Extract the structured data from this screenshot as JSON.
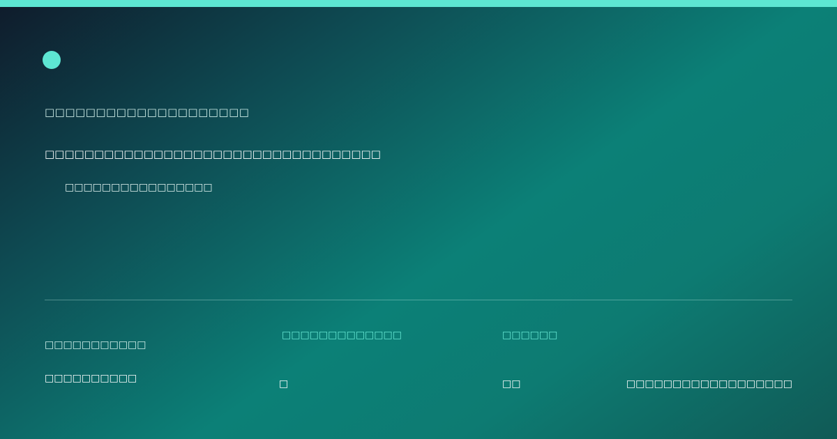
{
  "brand": {
    "accent_color": "#5de6d2",
    "logo_shape": "dot"
  },
  "hero": {
    "kicker": "□□□□□□□□□□□□□□□□□□□□",
    "headline": "□□□□□□□□□□□□□□□□□□□□□□□□□□□□□□□□□□",
    "subline": "□□□□□□□□□□□□□□□□"
  },
  "footer": {
    "field_1": {
      "label": "□□□□□□□□□□□",
      "value": "□□□□□□□□□□"
    },
    "field_2": {
      "label": "□□□□□□□□□□□□□",
      "value": "□"
    },
    "field_3": {
      "label": "□□□□□□",
      "value": "□□"
    },
    "field_4": {
      "value": "□□□□□□□□□□□□□□□□□□"
    }
  }
}
